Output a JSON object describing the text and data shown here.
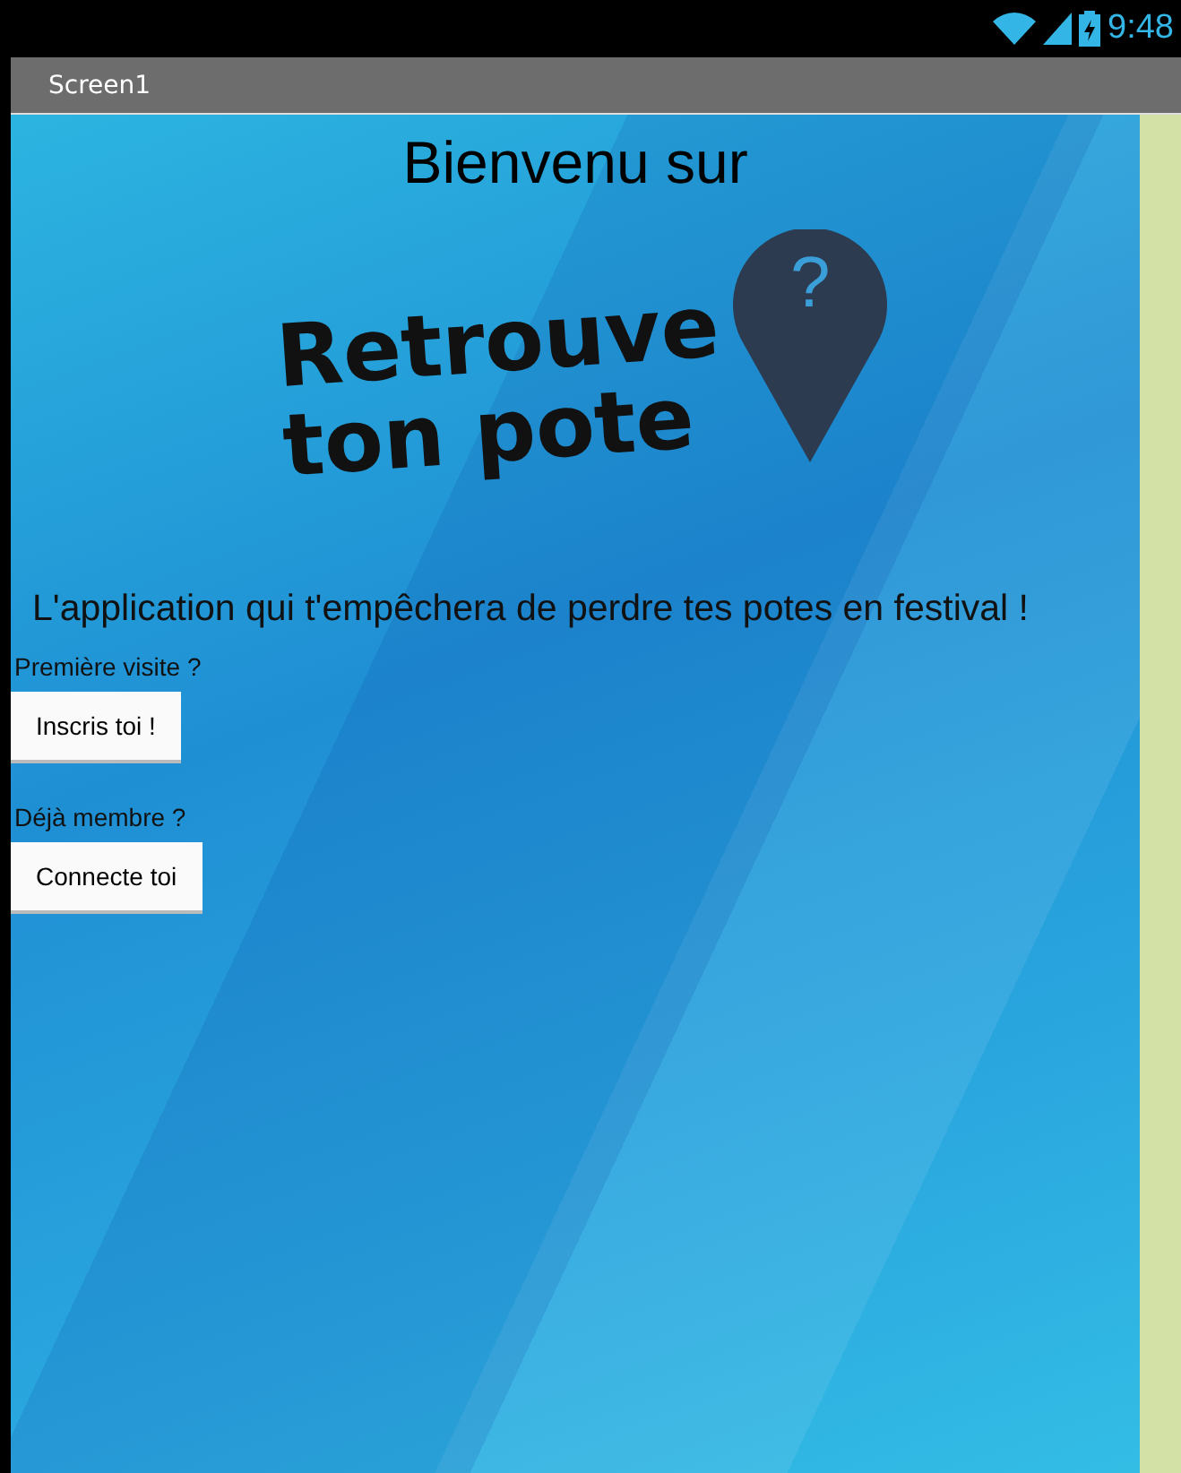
{
  "status_bar": {
    "time": "9:48"
  },
  "title_bar": {
    "title": "Screen1"
  },
  "screen": {
    "heading": "Bienvenu sur",
    "logo": {
      "lines": [
        "Retrouve",
        "ton pote"
      ],
      "pin_mark": "?"
    },
    "tagline": "L'application qui t'empêchera de perdre tes potes en festival !",
    "sections": [
      {
        "label": "Première visite ?",
        "button": "Inscris toi !"
      },
      {
        "label": "Déjà membre ?",
        "button": "Connecte toi"
      }
    ]
  }
}
